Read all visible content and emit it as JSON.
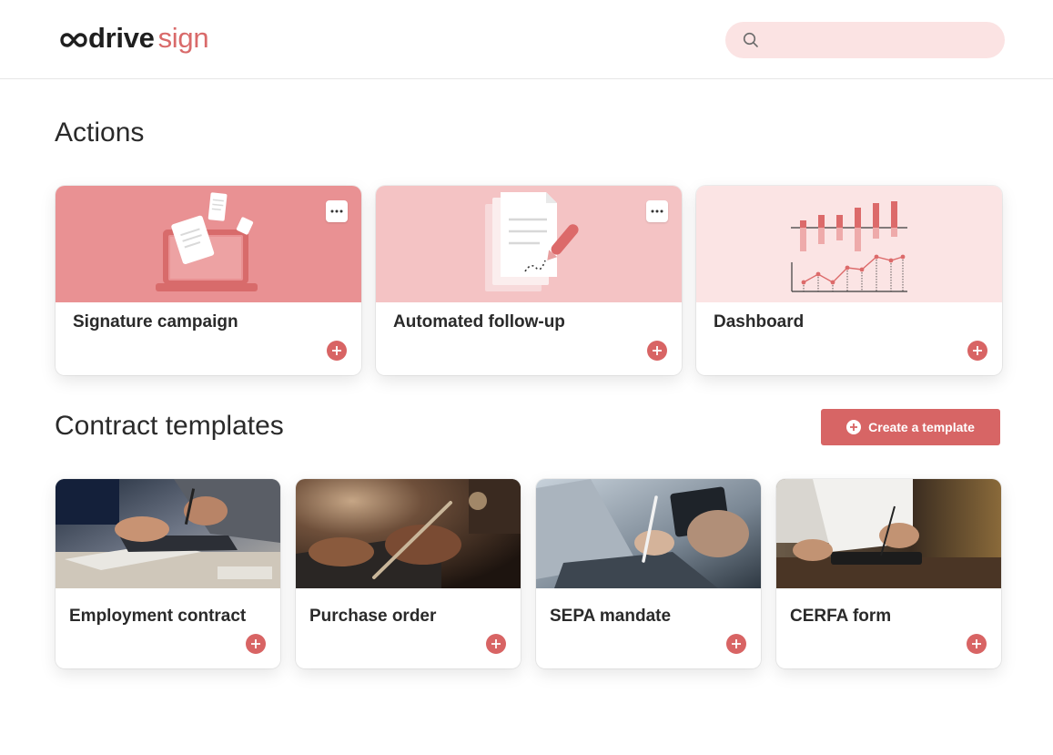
{
  "header": {
    "logo_word": "drive",
    "logo_suffix": "sign",
    "search_placeholder": ""
  },
  "actions": {
    "title": "Actions",
    "cards": [
      {
        "label": "Signature campaign",
        "banner_color": "#e99193",
        "icon": "laptop-documents-illustration"
      },
      {
        "label": "Automated follow-up",
        "banner_color": "#f4c3c4",
        "icon": "signed-document-illustration"
      },
      {
        "label": "Dashboard",
        "banner_color": "#fbe4e4",
        "icon": "bar-line-chart-illustration"
      }
    ]
  },
  "templates": {
    "title": "Contract templates",
    "create_label": "Create a template",
    "cards": [
      {
        "label": "Employment contract",
        "image": "hands-tablet-photo"
      },
      {
        "label": "Purchase order",
        "image": "hand-stylus-photo"
      },
      {
        "label": "SEPA mandate",
        "image": "laptop-stylus-photo"
      },
      {
        "label": "CERFA form",
        "image": "man-tablet-photo"
      }
    ]
  },
  "colors": {
    "accent": "#d76565",
    "search_bg": "#fbe3e3",
    "text": "#2a2a2a"
  }
}
